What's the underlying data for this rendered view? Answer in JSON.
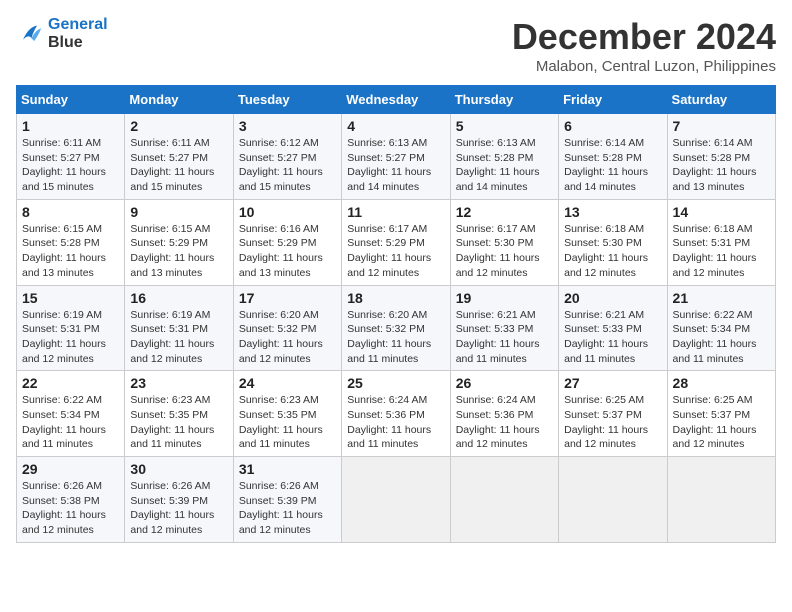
{
  "header": {
    "logo_line1": "General",
    "logo_line2": "Blue",
    "title": "December 2024",
    "subtitle": "Malabon, Central Luzon, Philippines"
  },
  "calendar": {
    "weekdays": [
      "Sunday",
      "Monday",
      "Tuesday",
      "Wednesday",
      "Thursday",
      "Friday",
      "Saturday"
    ],
    "weeks": [
      [
        {
          "day": "1",
          "sunrise": "6:11 AM",
          "sunset": "5:27 PM",
          "daylight": "11 hours and 15 minutes."
        },
        {
          "day": "2",
          "sunrise": "6:11 AM",
          "sunset": "5:27 PM",
          "daylight": "11 hours and 15 minutes."
        },
        {
          "day": "3",
          "sunrise": "6:12 AM",
          "sunset": "5:27 PM",
          "daylight": "11 hours and 15 minutes."
        },
        {
          "day": "4",
          "sunrise": "6:13 AM",
          "sunset": "5:27 PM",
          "daylight": "11 hours and 14 minutes."
        },
        {
          "day": "5",
          "sunrise": "6:13 AM",
          "sunset": "5:28 PM",
          "daylight": "11 hours and 14 minutes."
        },
        {
          "day": "6",
          "sunrise": "6:14 AM",
          "sunset": "5:28 PM",
          "daylight": "11 hours and 14 minutes."
        },
        {
          "day": "7",
          "sunrise": "6:14 AM",
          "sunset": "5:28 PM",
          "daylight": "11 hours and 13 minutes."
        }
      ],
      [
        {
          "day": "8",
          "sunrise": "6:15 AM",
          "sunset": "5:28 PM",
          "daylight": "11 hours and 13 minutes."
        },
        {
          "day": "9",
          "sunrise": "6:15 AM",
          "sunset": "5:29 PM",
          "daylight": "11 hours and 13 minutes."
        },
        {
          "day": "10",
          "sunrise": "6:16 AM",
          "sunset": "5:29 PM",
          "daylight": "11 hours and 13 minutes."
        },
        {
          "day": "11",
          "sunrise": "6:17 AM",
          "sunset": "5:29 PM",
          "daylight": "11 hours and 12 minutes."
        },
        {
          "day": "12",
          "sunrise": "6:17 AM",
          "sunset": "5:30 PM",
          "daylight": "11 hours and 12 minutes."
        },
        {
          "day": "13",
          "sunrise": "6:18 AM",
          "sunset": "5:30 PM",
          "daylight": "11 hours and 12 minutes."
        },
        {
          "day": "14",
          "sunrise": "6:18 AM",
          "sunset": "5:31 PM",
          "daylight": "11 hours and 12 minutes."
        }
      ],
      [
        {
          "day": "15",
          "sunrise": "6:19 AM",
          "sunset": "5:31 PM",
          "daylight": "11 hours and 12 minutes."
        },
        {
          "day": "16",
          "sunrise": "6:19 AM",
          "sunset": "5:31 PM",
          "daylight": "11 hours and 12 minutes."
        },
        {
          "day": "17",
          "sunrise": "6:20 AM",
          "sunset": "5:32 PM",
          "daylight": "11 hours and 12 minutes."
        },
        {
          "day": "18",
          "sunrise": "6:20 AM",
          "sunset": "5:32 PM",
          "daylight": "11 hours and 11 minutes."
        },
        {
          "day": "19",
          "sunrise": "6:21 AM",
          "sunset": "5:33 PM",
          "daylight": "11 hours and 11 minutes."
        },
        {
          "day": "20",
          "sunrise": "6:21 AM",
          "sunset": "5:33 PM",
          "daylight": "11 hours and 11 minutes."
        },
        {
          "day": "21",
          "sunrise": "6:22 AM",
          "sunset": "5:34 PM",
          "daylight": "11 hours and 11 minutes."
        }
      ],
      [
        {
          "day": "22",
          "sunrise": "6:22 AM",
          "sunset": "5:34 PM",
          "daylight": "11 hours and 11 minutes."
        },
        {
          "day": "23",
          "sunrise": "6:23 AM",
          "sunset": "5:35 PM",
          "daylight": "11 hours and 11 minutes."
        },
        {
          "day": "24",
          "sunrise": "6:23 AM",
          "sunset": "5:35 PM",
          "daylight": "11 hours and 11 minutes."
        },
        {
          "day": "25",
          "sunrise": "6:24 AM",
          "sunset": "5:36 PM",
          "daylight": "11 hours and 11 minutes."
        },
        {
          "day": "26",
          "sunrise": "6:24 AM",
          "sunset": "5:36 PM",
          "daylight": "11 hours and 12 minutes."
        },
        {
          "day": "27",
          "sunrise": "6:25 AM",
          "sunset": "5:37 PM",
          "daylight": "11 hours and 12 minutes."
        },
        {
          "day": "28",
          "sunrise": "6:25 AM",
          "sunset": "5:37 PM",
          "daylight": "11 hours and 12 minutes."
        }
      ],
      [
        {
          "day": "29",
          "sunrise": "6:26 AM",
          "sunset": "5:38 PM",
          "daylight": "11 hours and 12 minutes."
        },
        {
          "day": "30",
          "sunrise": "6:26 AM",
          "sunset": "5:39 PM",
          "daylight": "11 hours and 12 minutes."
        },
        {
          "day": "31",
          "sunrise": "6:26 AM",
          "sunset": "5:39 PM",
          "daylight": "11 hours and 12 minutes."
        },
        null,
        null,
        null,
        null
      ]
    ]
  }
}
